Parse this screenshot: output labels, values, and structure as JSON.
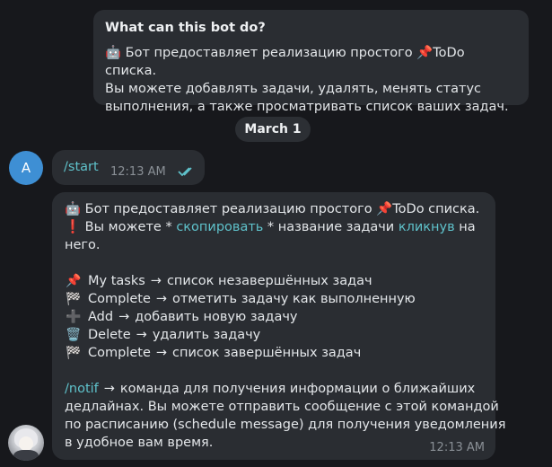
{
  "intro": {
    "title": "What can this bot do?",
    "body": "🤖 Бот предоставляет реализацию простого 📌ToDo списка.\nВы можете добавлять задачи, удалять, менять статус\nвыполнения, а также просматривать список ваших задач."
  },
  "date_divider": "March 1",
  "user": {
    "avatar_letter": "A",
    "avatar_color": "#3e8fd4",
    "message": "/start",
    "time": "12:13 AM",
    "read_status": "double-check-icon"
  },
  "bot_message": {
    "line1": "🤖 Бот предоставляет реализацию простого 📌ToDo списка.",
    "line2_prefix": "❗ Вы можете * ",
    "line2_link1": "скопировать",
    "line2_mid": " * название задачи ",
    "line2_link2": "кликнув",
    "line2_suffix": " на",
    "line3": "него.",
    "commands": [
      {
        "icon": "📌",
        "name": "My tasks",
        "desc": "список незавершённых задач"
      },
      {
        "icon": "🏁",
        "name": "Complete",
        "desc": "отметить задачу как выполненную"
      },
      {
        "icon": "➕",
        "name": "Add",
        "desc": "добавить новую задачу"
      },
      {
        "icon": "🗑️",
        "name": "Delete",
        "desc": "удалить задачу"
      },
      {
        "icon": "🏁",
        "name": "Complete",
        "desc": "список завершённых задач"
      }
    ],
    "arrow": "→",
    "notif_cmd": "/notif",
    "notif_line1": "команда для получения информации о ближайших",
    "notif_line2": "дедлайнах. Вы можете отправить сообщение с этой командой",
    "notif_line3": "по расписанию (schedule message) для получения уведомления",
    "notif_line4": "в удобное вам время.",
    "time": "12:13 AM"
  },
  "colors": {
    "background": "#17181c",
    "bubble": "#2a2d32",
    "link": "#5fc2cb",
    "time": "#8a9096"
  }
}
